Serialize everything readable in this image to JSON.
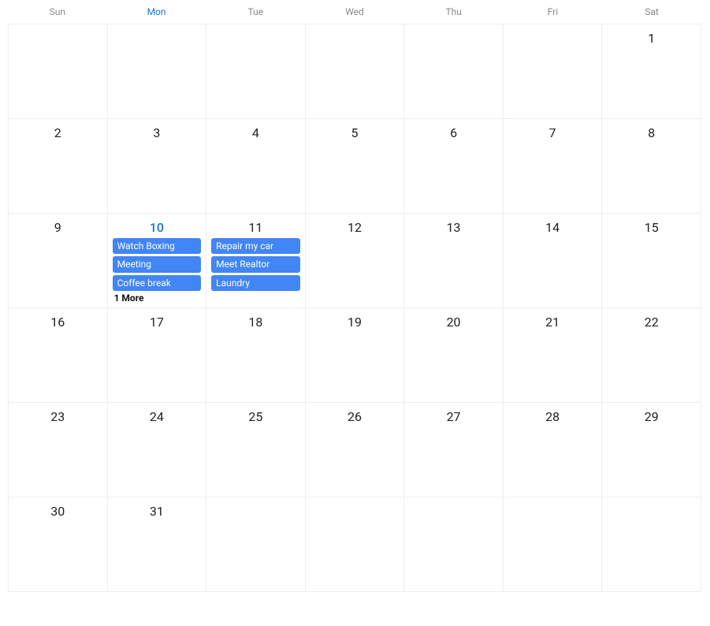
{
  "weekdays": [
    "Sun",
    "Mon",
    "Tue",
    "Wed",
    "Thu",
    "Fri",
    "Sat"
  ],
  "today_column_index": 1,
  "cells": [
    {
      "day": "",
      "today": false,
      "events": [],
      "more": ""
    },
    {
      "day": "",
      "today": false,
      "events": [],
      "more": ""
    },
    {
      "day": "",
      "today": false,
      "events": [],
      "more": ""
    },
    {
      "day": "",
      "today": false,
      "events": [],
      "more": ""
    },
    {
      "day": "",
      "today": false,
      "events": [],
      "more": ""
    },
    {
      "day": "",
      "today": false,
      "events": [],
      "more": ""
    },
    {
      "day": "1",
      "today": false,
      "events": [],
      "more": ""
    },
    {
      "day": "2",
      "today": false,
      "events": [],
      "more": ""
    },
    {
      "day": "3",
      "today": false,
      "events": [],
      "more": ""
    },
    {
      "day": "4",
      "today": false,
      "events": [],
      "more": ""
    },
    {
      "day": "5",
      "today": false,
      "events": [],
      "more": ""
    },
    {
      "day": "6",
      "today": false,
      "events": [],
      "more": ""
    },
    {
      "day": "7",
      "today": false,
      "events": [],
      "more": ""
    },
    {
      "day": "8",
      "today": false,
      "events": [],
      "more": ""
    },
    {
      "day": "9",
      "today": false,
      "events": [],
      "more": ""
    },
    {
      "day": "10",
      "today": true,
      "events": [
        "Watch Boxing",
        "Meeting",
        "Coffee break"
      ],
      "more": "1 More"
    },
    {
      "day": "11",
      "today": false,
      "events": [
        "Repair my car",
        "Meet Realtor",
        "Laundry"
      ],
      "more": ""
    },
    {
      "day": "12",
      "today": false,
      "events": [],
      "more": ""
    },
    {
      "day": "13",
      "today": false,
      "events": [],
      "more": ""
    },
    {
      "day": "14",
      "today": false,
      "events": [],
      "more": ""
    },
    {
      "day": "15",
      "today": false,
      "events": [],
      "more": ""
    },
    {
      "day": "16",
      "today": false,
      "events": [],
      "more": ""
    },
    {
      "day": "17",
      "today": false,
      "events": [],
      "more": ""
    },
    {
      "day": "18",
      "today": false,
      "events": [],
      "more": ""
    },
    {
      "day": "19",
      "today": false,
      "events": [],
      "more": ""
    },
    {
      "day": "20",
      "today": false,
      "events": [],
      "more": ""
    },
    {
      "day": "21",
      "today": false,
      "events": [],
      "more": ""
    },
    {
      "day": "22",
      "today": false,
      "events": [],
      "more": ""
    },
    {
      "day": "23",
      "today": false,
      "events": [],
      "more": ""
    },
    {
      "day": "24",
      "today": false,
      "events": [],
      "more": ""
    },
    {
      "day": "25",
      "today": false,
      "events": [],
      "more": ""
    },
    {
      "day": "26",
      "today": false,
      "events": [],
      "more": ""
    },
    {
      "day": "27",
      "today": false,
      "events": [],
      "more": ""
    },
    {
      "day": "28",
      "today": false,
      "events": [],
      "more": ""
    },
    {
      "day": "29",
      "today": false,
      "events": [],
      "more": ""
    },
    {
      "day": "30",
      "today": false,
      "events": [],
      "more": ""
    },
    {
      "day": "31",
      "today": false,
      "events": [],
      "more": ""
    },
    {
      "day": "",
      "today": false,
      "events": [],
      "more": ""
    },
    {
      "day": "",
      "today": false,
      "events": [],
      "more": ""
    },
    {
      "day": "",
      "today": false,
      "events": [],
      "more": ""
    },
    {
      "day": "",
      "today": false,
      "events": [],
      "more": ""
    },
    {
      "day": "",
      "today": false,
      "events": [],
      "more": ""
    }
  ]
}
